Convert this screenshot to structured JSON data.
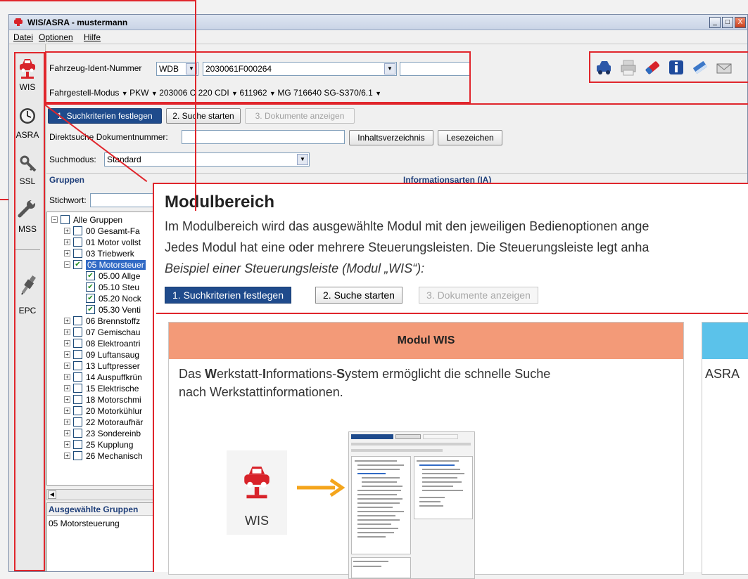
{
  "window": {
    "title": "WIS/ASRA - mustermann",
    "controls": {
      "minimize": "_",
      "maximize": "□",
      "close": "X"
    }
  },
  "menu": {
    "items": [
      "Datei",
      "Optionen",
      "Hilfe"
    ]
  },
  "sidebar": {
    "items": [
      {
        "label": "WIS",
        "icon": "car-lift-icon"
      },
      {
        "label": "ASRA",
        "icon": "stopwatch-icon"
      },
      {
        "label": "SSL",
        "icon": "key-icon"
      },
      {
        "label": "MSS",
        "icon": "wrench-icon"
      },
      {
        "label": "EPC",
        "icon": "spark-plug-icon"
      }
    ]
  },
  "vehicle": {
    "vin_label": "Fahrzeug-Ident-Nummer",
    "vin_prefix": "WDB",
    "vin_value": "2030061F000264",
    "chassis_mode": "Fahrgestell-Modus",
    "chassis_type": "PKW",
    "model": "203006 C 220 CDI",
    "engine": "611962",
    "transmission": "MG 716640 SG-S370/6.1"
  },
  "toolbar": {
    "icons": [
      "car-print-icon",
      "printer-icon",
      "eraser-icon",
      "info-icon",
      "book-icon",
      "envelope-icon"
    ]
  },
  "steps": {
    "step1": "1. Suchkriterien festlegen",
    "step2": "2. Suche starten",
    "step3": "3. Dokumente anzeigen"
  },
  "search": {
    "direct_label": "Direktsuche Dokumentnummer:",
    "toc_button": "Inhaltsverzeichnis",
    "bookmarks_button": "Lesezeichen",
    "mode_label": "Suchmodus:",
    "mode_value": "Standard",
    "groups_header": "Gruppen",
    "keyword_label": "Stichwort:",
    "infotypes_header": "Informationsarten (IA)"
  },
  "tree": {
    "rows": [
      {
        "text": "Alle Gruppen",
        "level": 0,
        "checked": false
      },
      {
        "text": "00  Gesamt-Fa",
        "level": 1,
        "checked": false
      },
      {
        "text": "01  Motor vollst",
        "level": 1,
        "checked": false
      },
      {
        "text": "03  Triebwerk",
        "level": 1,
        "checked": false
      },
      {
        "text": "05  Motorsteuer",
        "level": 1,
        "checked": true,
        "selected": true
      },
      {
        "text": "05.00  Allge",
        "level": 2,
        "checked": true
      },
      {
        "text": "05.10  Steu",
        "level": 2,
        "checked": true
      },
      {
        "text": "05.20  Nock",
        "level": 2,
        "checked": true
      },
      {
        "text": "05.30  Venti",
        "level": 2,
        "checked": true
      },
      {
        "text": "06  Brennstoffz",
        "level": 1,
        "checked": false
      },
      {
        "text": "07  Gemischau",
        "level": 1,
        "checked": false
      },
      {
        "text": "08  Elektroantri",
        "level": 1,
        "checked": false
      },
      {
        "text": "09  Luftansaug",
        "level": 1,
        "checked": false
      },
      {
        "text": "13  Luftpresser",
        "level": 1,
        "checked": false
      },
      {
        "text": "14  Auspuffkrün",
        "level": 1,
        "checked": false
      },
      {
        "text": "15  Elektrische",
        "level": 1,
        "checked": false
      },
      {
        "text": "18  Motorschmi",
        "level": 1,
        "checked": false
      },
      {
        "text": "20  Motorkühlur",
        "level": 1,
        "checked": false
      },
      {
        "text": "22  Motoraufhär",
        "level": 1,
        "checked": false
      },
      {
        "text": "23  Sondereinb",
        "level": 1,
        "checked": false
      },
      {
        "text": "25  Kupplung",
        "level": 1,
        "checked": false
      },
      {
        "text": "26  Mechanisch",
        "level": 1,
        "checked": false
      }
    ]
  },
  "selected_groups": {
    "header": "Ausgewählte Gruppen",
    "items": [
      "05  Motorsteuerung"
    ]
  },
  "panel": {
    "title": "Modulbereich",
    "line1": "Im Modulbereich wird das ausgewählte Modul mit den jeweiligen Bedienoptionen ange",
    "line2": "Jedes Modul hat eine oder mehrere Steuerungsleisten. Die Steuerungsleiste legt anha",
    "line3": "Beispiel einer Steuerungsleiste (Modul „WIS“):",
    "card_wis_title": "Modul WIS",
    "card_wis_text_1": "Das ",
    "card_wis_text_W": "W",
    "card_wis_text_2": "erkstatt-",
    "card_wis_text_I": "I",
    "card_wis_text_3": "nformations-",
    "card_wis_text_S": "S",
    "card_wis_text_4": "ystem ermöglicht die schnelle Suche",
    "card_wis_text_line2": "nach Werkstattinformationen.",
    "card_wis_icon_label": "WIS",
    "card_asra_text": "ASRA",
    "colors": {
      "wis_head": "#f39a78",
      "asra_head": "#5bc2ea",
      "highlight": "#e0262c"
    }
  }
}
